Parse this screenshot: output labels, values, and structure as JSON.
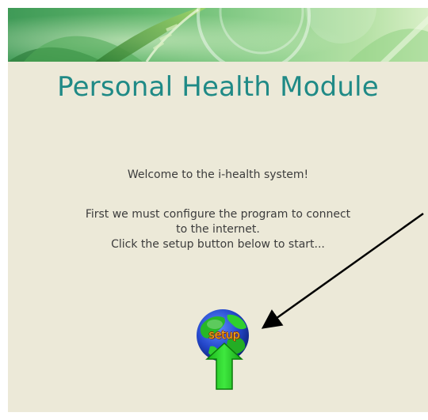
{
  "header": {
    "title": "Personal Health Module"
  },
  "main": {
    "welcome": "Welcome to the i-health system!",
    "instructions": [
      "First we must configure the program to connect",
      "to the internet.",
      "Click the setup button below to start..."
    ],
    "setup_button": {
      "label": "setup",
      "icon": "globe-icon"
    }
  },
  "colors": {
    "background": "#ece9d8",
    "title": "#1f8a86",
    "text": "#3c3c3c",
    "accent": "#22c322"
  }
}
